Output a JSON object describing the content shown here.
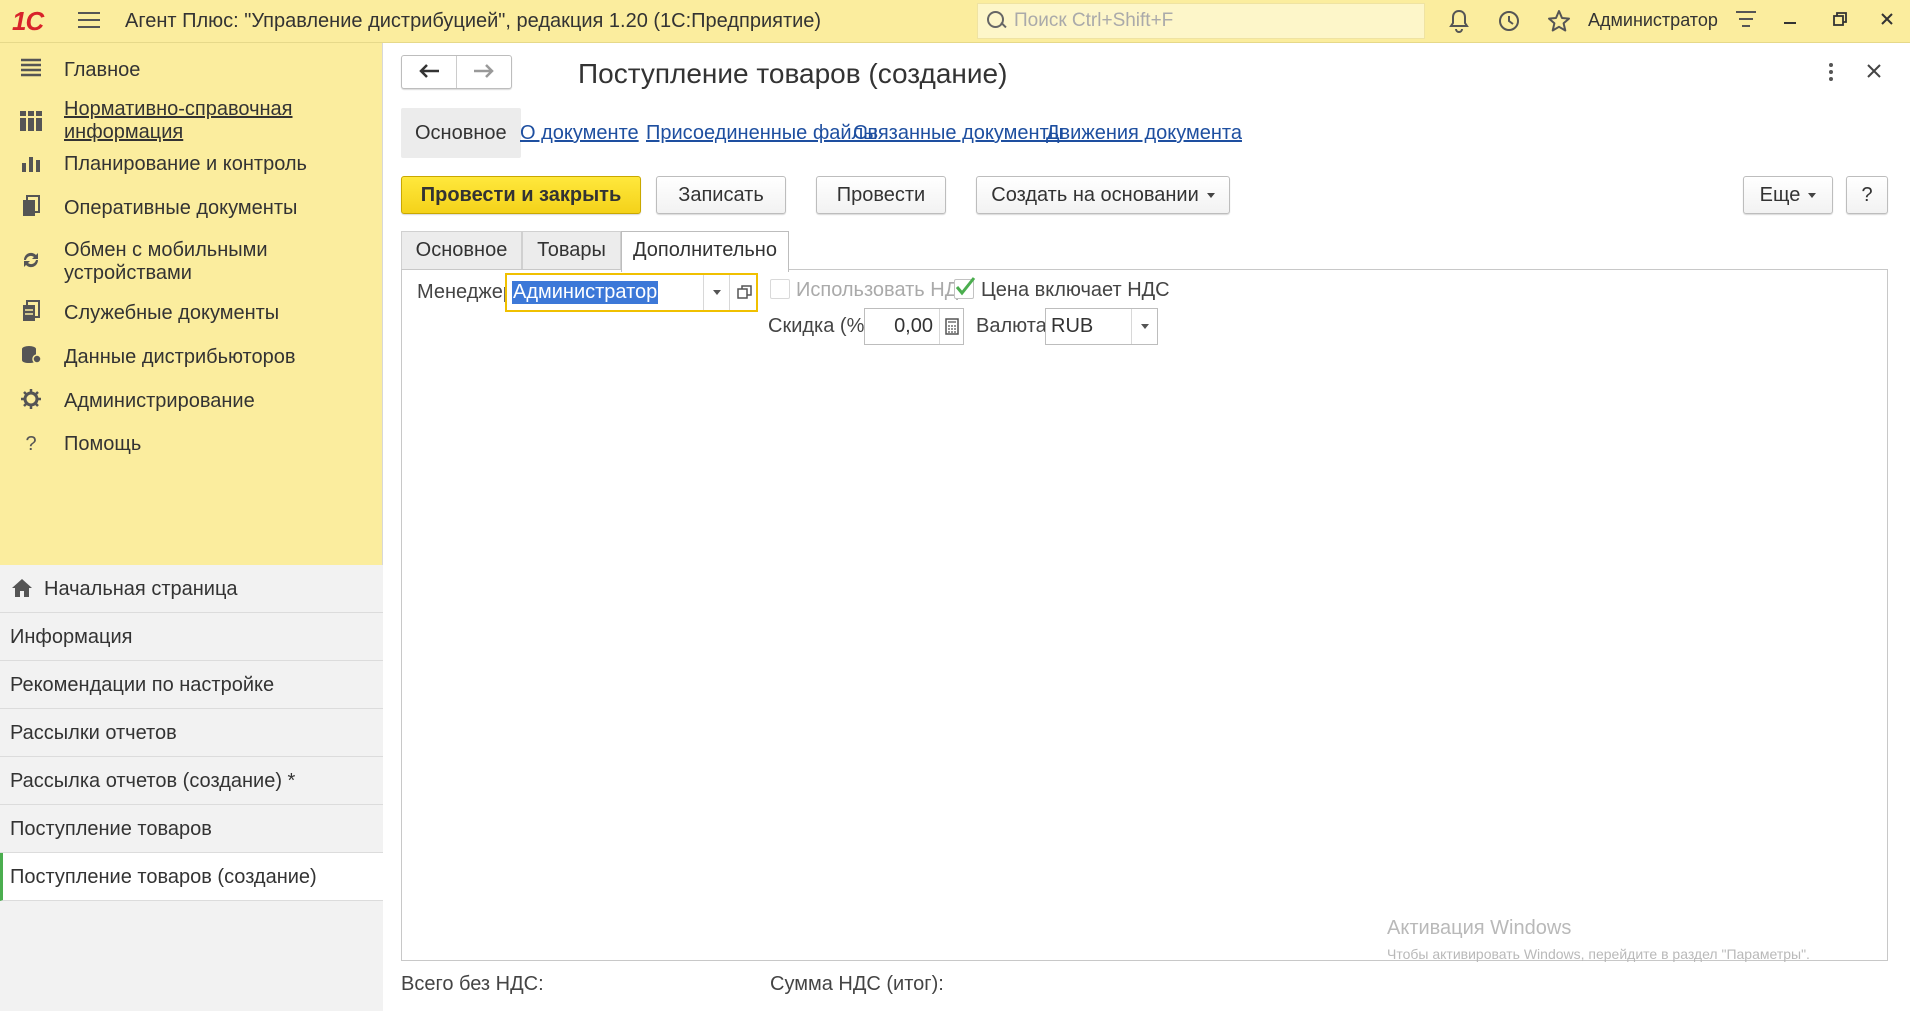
{
  "titlebar": {
    "logo_text": "1С",
    "app_title": "Агент Плюс: \"Управление дистрибуцией\", редакция 1.20  (1С:Предприятие)",
    "search_placeholder": "Поиск Ctrl+Shift+F",
    "user_name": "Администратор",
    "icons": [
      "menu-icon",
      "bell-icon",
      "history-icon",
      "star-icon",
      "settings-lines-icon",
      "minimize-icon",
      "restore-icon",
      "close-icon"
    ]
  },
  "sidebar": {
    "sections": [
      {
        "label": "Главное",
        "icon": "menu-lines-icon",
        "link": false
      },
      {
        "label": "Нормативно-справочная информация",
        "icon": "table-icon",
        "link": true
      },
      {
        "label": "Планирование и контроль",
        "icon": "bar-chart-icon",
        "link": false
      },
      {
        "label": "Оперативные документы",
        "icon": "documents-icon",
        "link": false
      },
      {
        "label": "Обмен с мобильными устройствами",
        "icon": "sync-icon",
        "link": false
      },
      {
        "label": "Служебные документы",
        "icon": "service-docs-icon",
        "link": false
      },
      {
        "label": "Данные дистрибьюторов",
        "icon": "database-icon",
        "link": false
      },
      {
        "label": "Администрирование",
        "icon": "gear-icon",
        "link": false
      },
      {
        "label": "Помощь",
        "icon": "question-icon",
        "link": false
      }
    ],
    "open_windows": [
      "Начальная страница",
      "Информация",
      "Рекомендации по настройке",
      "Рассылки отчетов",
      "Рассылка отчетов (создание) *",
      "Поступление товаров",
      "Поступление товаров (создание)"
    ]
  },
  "form": {
    "title": "Поступление товаров (создание)",
    "nav_tabs": [
      "Основное",
      "О документе",
      "Присоединенные файлы",
      "Связанные документы",
      "Движения документа"
    ],
    "commands": {
      "post_close": "Провести и закрыть",
      "save": "Записать",
      "post": "Провести",
      "create_based": "Создать на основании",
      "more": "Еще",
      "help": "?"
    },
    "inner_tabs": [
      "Основное",
      "Товары",
      "Дополнительно"
    ],
    "active_inner_tab": "Дополнительно",
    "fields": {
      "manager_label": "Менеджер:",
      "manager_value": "Администратор",
      "use_vat_label": "Использовать НДС",
      "use_vat_checked": false,
      "price_incl_vat_label": "Цена включает НДС",
      "price_incl_vat_checked": true,
      "discount_label": "Скидка (%):",
      "discount_value": "0,00",
      "currency_label": "Валюта:",
      "currency_value": "RUB"
    },
    "totals": {
      "total_no_vat_label": "Всего без НДС:",
      "vat_sum_label": "Сумма НДС (итог):"
    }
  },
  "watermark": {
    "line1": "Активация Windows",
    "line2": "Чтобы активировать Windows, перейдите в раздел \"Параметры\"."
  },
  "colors": {
    "panel_yellow": "#fbed9e",
    "primary_button": "#f4d21a",
    "link_blue": "#1e4fa0",
    "check_green": "#4bae4f"
  }
}
